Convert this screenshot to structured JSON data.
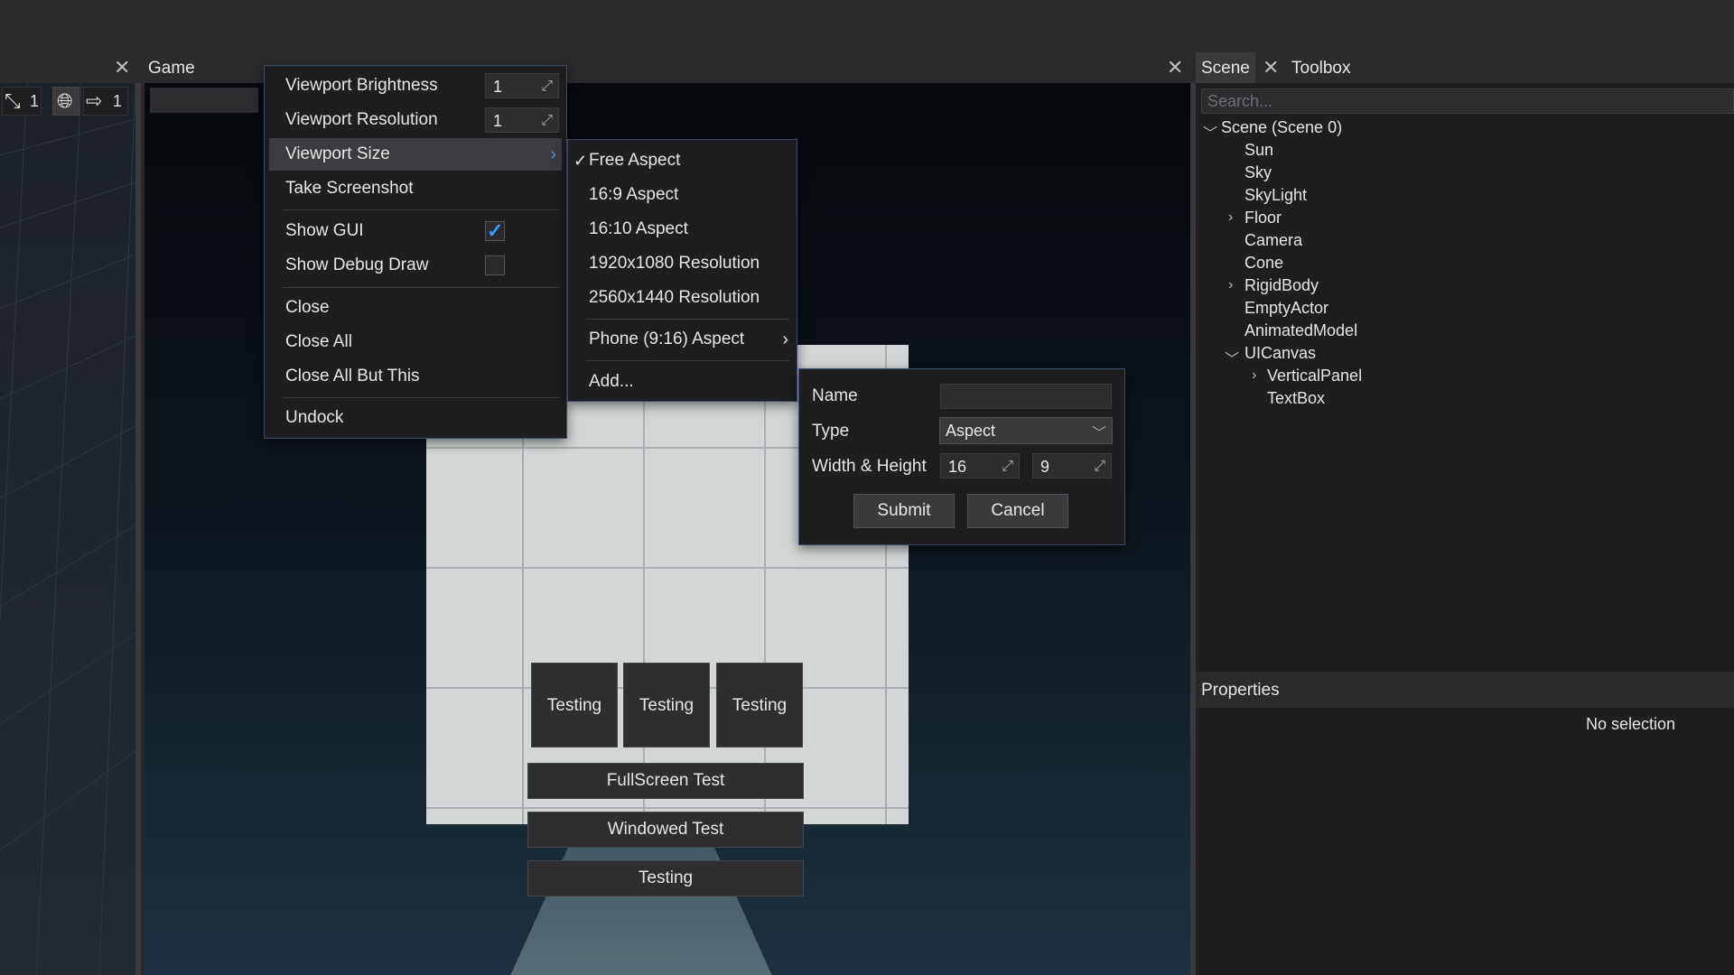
{
  "tabs": {
    "game": "Game",
    "scene": "Scene",
    "toolbox": "Toolbox"
  },
  "toolbar": {
    "move_value": "1",
    "step_value": "1"
  },
  "context_menu": {
    "brightness_label": "Viewport Brightness",
    "brightness_value": "1",
    "resolution_label": "Viewport Resolution",
    "resolution_value": "1",
    "size_label": "Viewport Size",
    "screenshot_label": "Take Screenshot",
    "show_gui_label": "Show GUI",
    "show_gui_checked": true,
    "debug_draw_label": "Show Debug Draw",
    "debug_draw_checked": false,
    "close_label": "Close",
    "close_all_label": "Close All",
    "close_all_but_label": "Close All But This",
    "undock_label": "Undock"
  },
  "size_submenu": {
    "free": "Free Aspect",
    "a169": "16:9 Aspect",
    "a1610": "16:10 Aspect",
    "r1080": "1920x1080 Resolution",
    "r1440": "2560x1440 Resolution",
    "phone": "Phone (9:16) Aspect",
    "add": "Add..."
  },
  "add_dialog": {
    "name_label": "Name",
    "name_value": "",
    "type_label": "Type",
    "type_value": "Aspect",
    "wh_label": "Width & Height",
    "width_value": "16",
    "height_value": "9",
    "submit": "Submit",
    "cancel": "Cancel"
  },
  "game_ui": {
    "testing_1": "Testing",
    "testing_2": "Testing",
    "testing_3": "Testing",
    "fullscreen": "FullScreen Test",
    "windowed": "Windowed Test",
    "testing_bottom": "Testing"
  },
  "scene_panel": {
    "search_placeholder": "Search...",
    "root": "Scene (Scene 0)",
    "items": {
      "sun": "Sun",
      "sky": "Sky",
      "skylight": "SkyLight",
      "floor": "Floor",
      "camera": "Camera",
      "cone": "Cone",
      "rigidbody": "RigidBody",
      "emptyactor": "EmptyActor",
      "animatedmodel": "AnimatedModel",
      "uicanvas": "UICanvas",
      "verticalpanel": "VerticalPanel",
      "textbox": "TextBox"
    }
  },
  "properties": {
    "title": "Properties",
    "empty": "No selection"
  },
  "colors": {
    "accent": "#3a7bd5",
    "panel_bg": "#1e1e20",
    "menu_border": "#3a4a6b"
  }
}
